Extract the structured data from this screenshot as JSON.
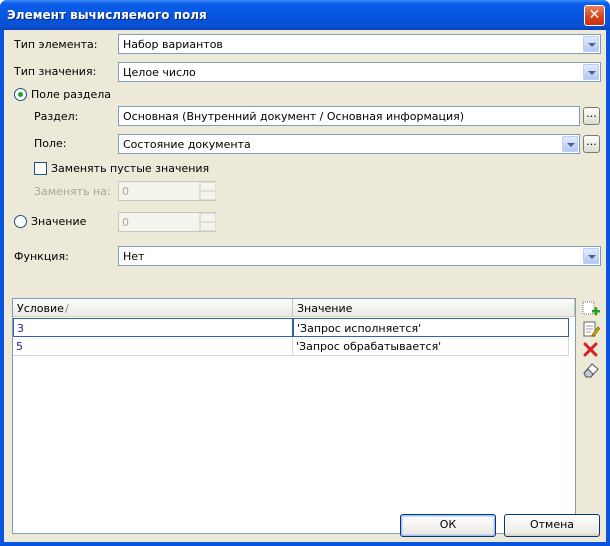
{
  "window": {
    "title": "Элемент вычисляемого поля",
    "close_label": "✕"
  },
  "element_type": {
    "label": "Тип элемента:",
    "value": "Набор вариантов"
  },
  "value_type": {
    "label": "Тип значения:",
    "value": "Целое число"
  },
  "section_field_radio": {
    "label": "Поле раздела",
    "checked": true
  },
  "section": {
    "label": "Раздел:",
    "value": "Основная (Внутренний документ / Основная информация)",
    "button": "..."
  },
  "field": {
    "label": "Поле:",
    "value": "Состояние документа",
    "button": "..."
  },
  "replace_empty": {
    "label": "Заменять пустые значения",
    "checked": false
  },
  "replace_with": {
    "label": "Заменять на:",
    "value": "0"
  },
  "value_radio": {
    "label": "Значение",
    "checked": false,
    "value": "0"
  },
  "function": {
    "label": "Функция:",
    "value": "Нет"
  },
  "grid": {
    "columns": [
      "Условие",
      "Значение"
    ],
    "sort_indicator": "/",
    "rows": [
      {
        "condition": "3",
        "value": "'Запрос исполняется'"
      },
      {
        "condition": "5",
        "value": "'Запрос обрабатывается'"
      }
    ]
  },
  "toolbar_icons": [
    "add-row-icon",
    "edit-row-icon",
    "delete-row-icon",
    "clear-icon"
  ],
  "buttons": {
    "ok": "ОК",
    "cancel": "Отмена"
  },
  "colors": {
    "titlebar": "#0656e2",
    "face": "#ece9d8",
    "delete": "#d82020",
    "add": "#22a022"
  }
}
